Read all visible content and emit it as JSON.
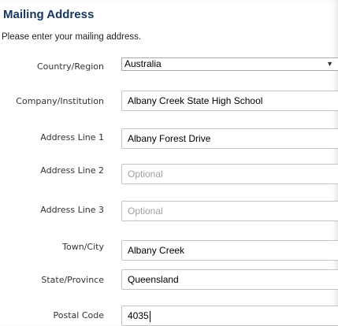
{
  "section": {
    "title": "Mailing Address",
    "instructions": "Please enter your mailing address."
  },
  "form": {
    "country_label": "Country/Region",
    "country_value": "Australia",
    "company_label": "Company/Institution",
    "company_value": "Albany Creek State High School",
    "address1_label": "Address Line 1",
    "address1_value": "Albany Forest Drive",
    "address2_label": "Address Line 2",
    "address2_placeholder": "Optional",
    "address3_label": "Address Line 3",
    "address3_placeholder": "Optional",
    "town_label": "Town/City",
    "town_value": "Albany Creek",
    "state_label": "State/Province",
    "state_value": "Queensland",
    "postal_label": "Postal Code",
    "postal_value": "4035"
  },
  "icons": {
    "select_arrow": "chevron-down-icon"
  }
}
